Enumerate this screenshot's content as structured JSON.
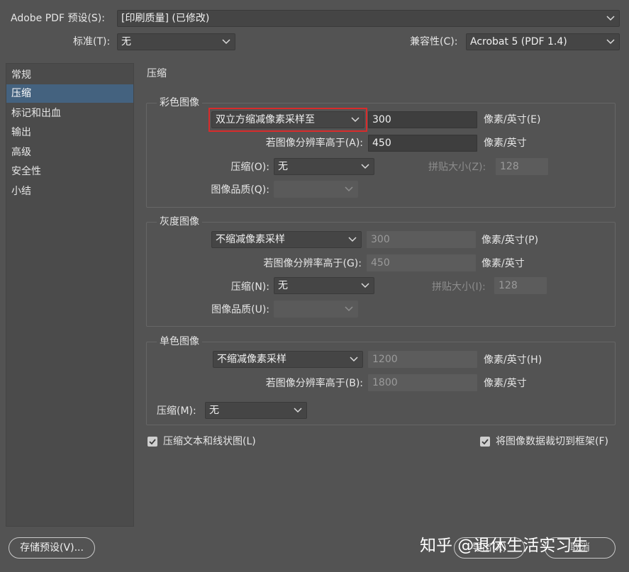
{
  "header": {
    "preset_label": "Adobe PDF 预设(S):",
    "preset_value": "[印刷质量] (已修改)",
    "standard_label": "标准(T):",
    "standard_value": "无",
    "compat_label": "兼容性(C):",
    "compat_value": "Acrobat 5 (PDF 1.4)"
  },
  "sidebar": {
    "items": [
      {
        "label": "常规"
      },
      {
        "label": "压缩"
      },
      {
        "label": "标记和出血"
      },
      {
        "label": "输出"
      },
      {
        "label": "高级"
      },
      {
        "label": "安全性"
      },
      {
        "label": "小结"
      }
    ],
    "active_index": 1
  },
  "section_title": "压缩",
  "color": {
    "title": "彩色图像",
    "sampling": "双立方缩减像素采样至",
    "ppi": "300",
    "ppi_unit": "像素/英寸(E)",
    "above_label": "若图像分辨率高于(A):",
    "above_value": "450",
    "above_unit": "像素/英寸",
    "compression_label": "压缩(O):",
    "compression_value": "无",
    "tile_label": "拼贴大小(Z):",
    "tile_value": "128",
    "quality_label": "图像品质(Q):",
    "quality_value": ""
  },
  "gray": {
    "title": "灰度图像",
    "sampling": "不缩减像素采样",
    "ppi": "300",
    "ppi_unit": "像素/英寸(P)",
    "above_label": "若图像分辨率高于(G):",
    "above_value": "450",
    "above_unit": "像素/英寸",
    "compression_label": "压缩(N):",
    "compression_value": "无",
    "tile_label": "拼贴大小(I):",
    "tile_value": "128",
    "quality_label": "图像品质(U):",
    "quality_value": ""
  },
  "mono": {
    "title": "单色图像",
    "sampling": "不缩减像素采样",
    "ppi": "1200",
    "ppi_unit": "像素/英寸(H)",
    "above_label": "若图像分辨率高于(B):",
    "above_value": "1800",
    "above_unit": "像素/英寸",
    "compression_label": "压缩(M):",
    "compression_value": "无"
  },
  "options": {
    "compress_text": "压缩文本和线状图(L)",
    "crop_image": "将图像数据裁切到框架(F)"
  },
  "footer": {
    "save_preset": "存储预设(V)...",
    "export": "导出(X)",
    "cancel": "取消",
    "watermark": "知乎 @退休生活实习生"
  },
  "colors": {
    "background": "#535353",
    "sidebar_active": "#44627f",
    "highlight": "#d92b2b"
  }
}
